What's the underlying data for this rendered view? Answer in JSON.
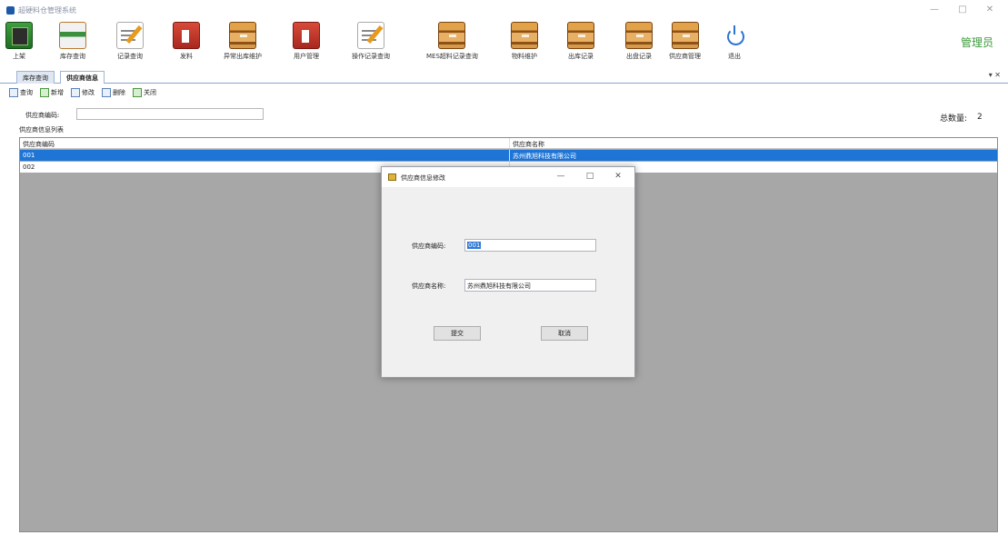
{
  "window": {
    "title": "超硬料仓管理系统",
    "controls": [
      "—",
      "□",
      "✕"
    ]
  },
  "ribbon": {
    "items": [
      {
        "label": "上架",
        "icon": "shelf-device-icon"
      },
      {
        "label": "库存查询",
        "icon": "app-window-icon"
      },
      {
        "label": "记录查询",
        "icon": "edit-notepad-icon"
      },
      {
        "label": "发料",
        "icon": "issue-material-icon"
      },
      {
        "label": "异常出库维护",
        "icon": "box-icon"
      },
      {
        "label": "用户管理",
        "icon": "user-admin-icon"
      },
      {
        "label": "操作记录查询",
        "icon": "edit-notepad-icon"
      },
      {
        "label": "MES超料记录查询",
        "icon": "box-icon"
      },
      {
        "label": "物料维护",
        "icon": "box-icon"
      },
      {
        "label": "出库记录",
        "icon": "box-icon"
      },
      {
        "label": "出盘记录",
        "icon": "box-icon"
      },
      {
        "label": "供应商管理",
        "icon": "box-icon"
      },
      {
        "label": "退出",
        "icon": "power-icon"
      }
    ],
    "user_role": "管理员"
  },
  "doc_tabs": [
    {
      "label": "库存查询",
      "active": false
    },
    {
      "label": "供应商信息",
      "active": true
    }
  ],
  "tab_close": "▾ ✕",
  "sub_toolbar": [
    {
      "label": "查询"
    },
    {
      "label": "新增"
    },
    {
      "label": "修改"
    },
    {
      "label": "删除"
    },
    {
      "label": "关闭"
    }
  ],
  "filter": {
    "label": "供应商编码:",
    "value": ""
  },
  "total": {
    "label": "总数量:",
    "value": "2"
  },
  "list_caption": "供应商信息列表",
  "grid": {
    "columns": [
      "供应商编码",
      "供应商名称"
    ],
    "rows": [
      {
        "code": "001",
        "name": "苏州鼎旭科技有限公司",
        "selected": true
      },
      {
        "code": "002",
        "name": "",
        "selected": false
      }
    ]
  },
  "dialog": {
    "title": "供应商信息修改",
    "controls": [
      "—",
      "□",
      "✕"
    ],
    "code_label": "供应商编码:",
    "code_value": "001",
    "name_label": "供应商名称:",
    "name_value": "苏州鼎旭科技有限公司",
    "confirm_label": "提交",
    "cancel_label": "取消"
  }
}
